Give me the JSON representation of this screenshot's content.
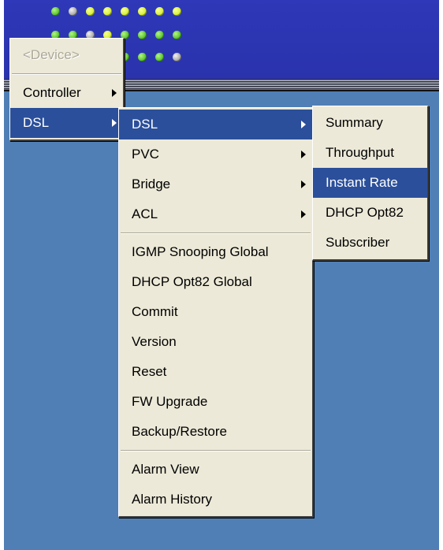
{
  "panel": {
    "leds_row1": [
      "mid",
      "off",
      "on",
      "on",
      "on",
      "on",
      "on",
      "on"
    ],
    "leds_row2": [
      "mid",
      "mid",
      "off",
      "on",
      "mid",
      "mid",
      "mid",
      "mid"
    ],
    "leds_row3": [
      "mid",
      "mid",
      "off",
      "mid",
      "mid",
      "mid",
      "mid",
      "off"
    ]
  },
  "menu_root": {
    "items": [
      {
        "label": "<Device>",
        "disabled": true
      },
      {
        "label": "Controller",
        "submenu": true
      },
      {
        "label": "DSL",
        "submenu": true,
        "active": true
      }
    ]
  },
  "menu_dsl": {
    "items": [
      {
        "label": "DSL",
        "submenu": true,
        "active": true
      },
      {
        "label": "PVC",
        "submenu": true
      },
      {
        "label": "Bridge",
        "submenu": true
      },
      {
        "label": "ACL",
        "submenu": true
      },
      {
        "label": "IGMP Snooping Global"
      },
      {
        "label": "DHCP Opt82 Global"
      },
      {
        "label": "Commit"
      },
      {
        "label": "Version"
      },
      {
        "label": "Reset"
      },
      {
        "label": "FW Upgrade"
      },
      {
        "label": "Backup/Restore"
      },
      {
        "label": "Alarm View"
      },
      {
        "label": "Alarm History"
      }
    ]
  },
  "menu_dsl_sub": {
    "items": [
      {
        "label": "Summary"
      },
      {
        "label": "Throughput"
      },
      {
        "label": "Instant Rate",
        "active": true
      },
      {
        "label": "DHCP Opt82"
      },
      {
        "label": "Subscriber"
      }
    ]
  },
  "colors": {
    "menu_bg": "#ece9d8",
    "highlight": "#2b4f9a",
    "app_bg": "#4f7fb5",
    "panel": "#2e38b8"
  }
}
